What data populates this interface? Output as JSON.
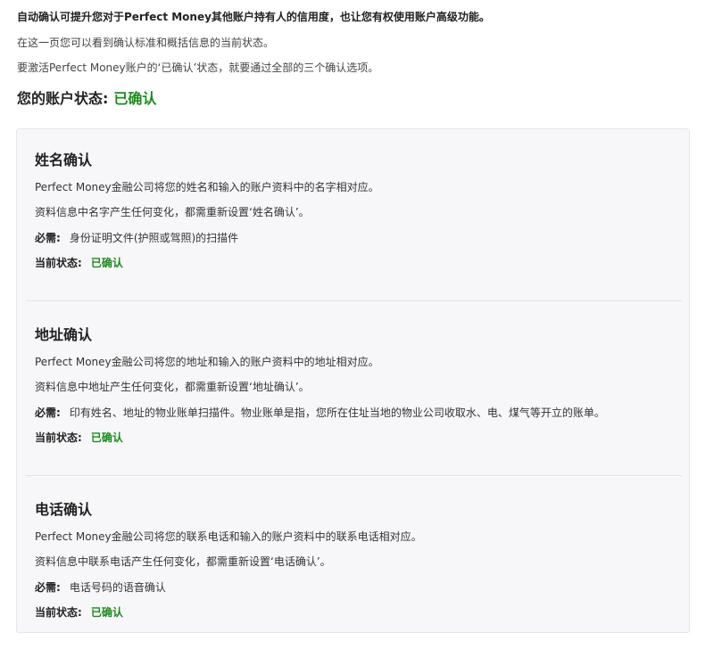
{
  "intro": {
    "bold": "自动确认可提升您对于Perfect Money其他账户持有人的信用度，也让您有权使用账户高级功能。",
    "line1": "在这一页您可以看到确认标准和概括信息的当前状态。",
    "line2": "要激活Perfect Money账户的‘已确认’状态，就要通过全部的三个确认选项。",
    "account_status_label": "您的账户状态:",
    "account_status_value": "已确认"
  },
  "sections": [
    {
      "title": "姓名确认",
      "desc1": "Perfect Money金融公司将您的姓名和输入的账户资料中的名字相对应。",
      "desc2": "资料信息中名字产生任何变化，都需重新设置‘姓名确认’。",
      "required_label": "必需:",
      "required_value": "身份证明文件(护照或驾照)的扫描件",
      "status_label": "当前状态:",
      "status_value": "已确认"
    },
    {
      "title": "地址确认",
      "desc1": "Perfect Money金融公司将您的地址和输入的账户资料中的地址相对应。",
      "desc2": "资料信息中地址产生任何变化，都需重新设置‘地址确认’。",
      "required_label": "必需:",
      "required_value": "印有姓名、地址的物业账单扫描件。物业账单是指，您所在住址当地的物业公司收取水、电、煤气等开立的账单。",
      "status_label": "当前状态:",
      "status_value": "已确认"
    },
    {
      "title": "电话确认",
      "desc1": "Perfect Money金融公司将您的联系电话和输入的账户资料中的联系电话相对应。",
      "desc2": "资料信息中联系电话产生任何变化，都需重新设置‘电话确认’。",
      "required_label": "必需:",
      "required_value": "电话号码的语音确认",
      "status_label": "当前状态:",
      "status_value": "已确认"
    }
  ],
  "colors": {
    "confirmed": "#1f8a1f",
    "panel_bg": "#f7f7f9"
  }
}
